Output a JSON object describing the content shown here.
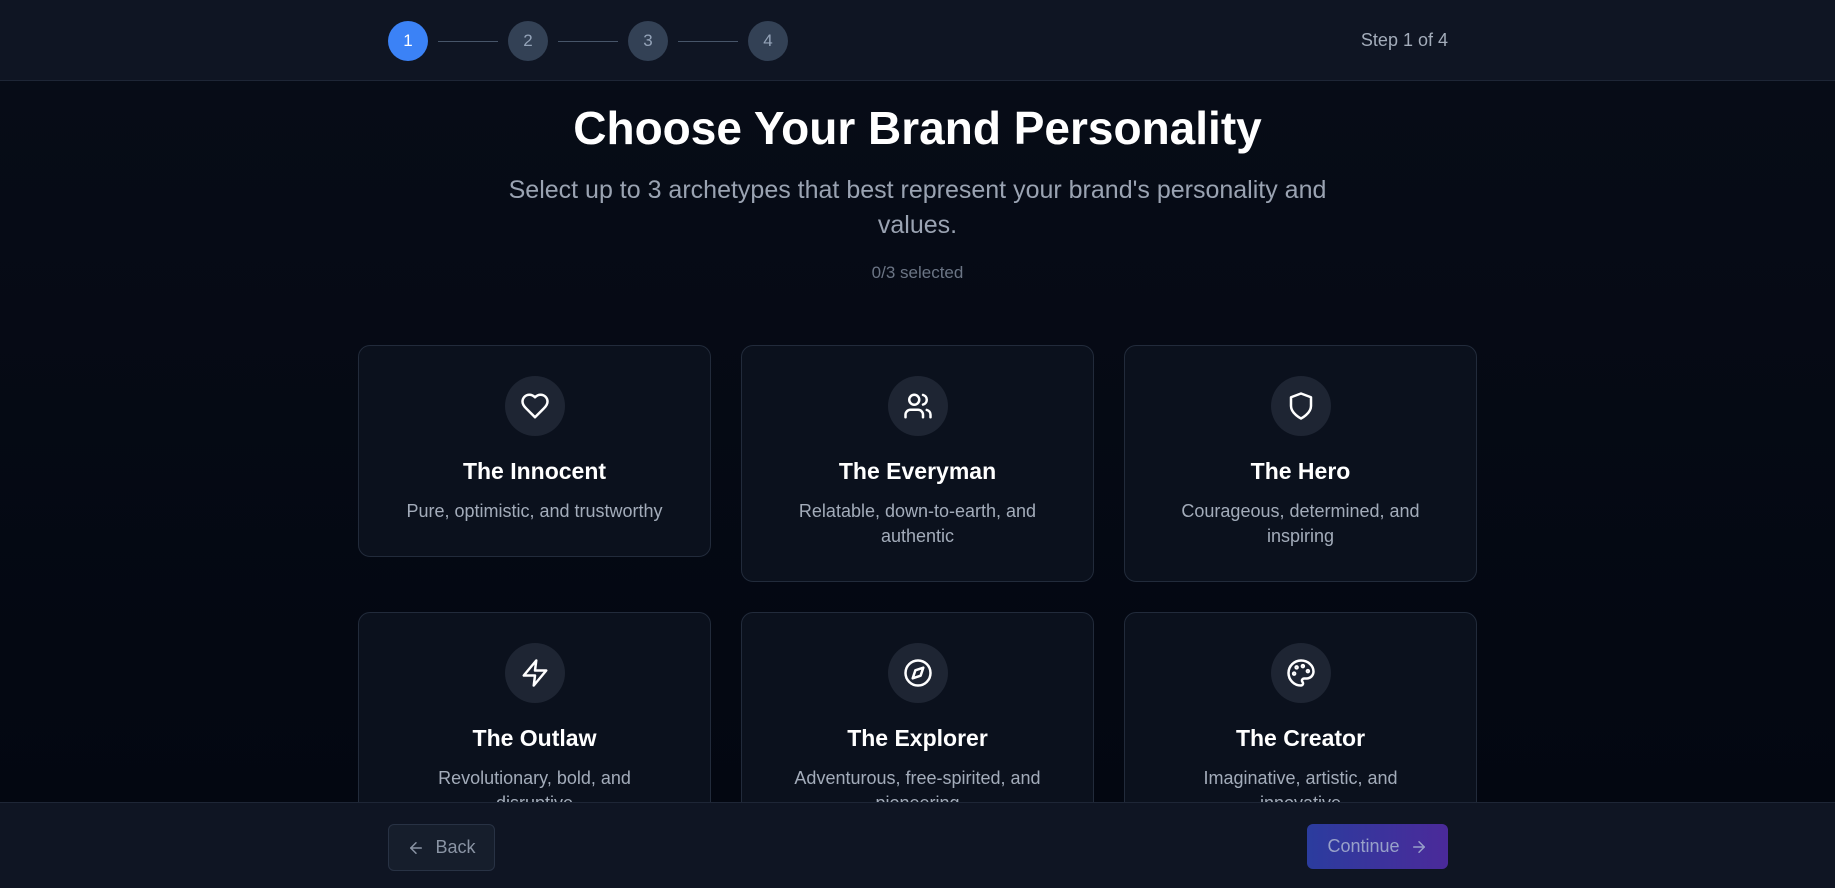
{
  "header": {
    "steps": [
      "1",
      "2",
      "3",
      "4"
    ],
    "active_step": 1,
    "step_label": "Step 1 of 4"
  },
  "main": {
    "title": "Choose Your Brand Personality",
    "subtitle": "Select up to 3 archetypes that best represent your brand's personality and values.",
    "counter": "0/3 selected"
  },
  "cards": [
    {
      "icon": "heart-icon",
      "title": "The Innocent",
      "desc": "Pure, optimistic, and trustworthy"
    },
    {
      "icon": "users-icon",
      "title": "The Everyman",
      "desc": "Relatable, down-to-earth, and authentic"
    },
    {
      "icon": "shield-icon",
      "title": "The Hero",
      "desc": "Courageous, determined, and inspiring"
    },
    {
      "icon": "lightning-icon",
      "title": "The Outlaw",
      "desc": "Revolutionary, bold, and disruptive"
    },
    {
      "icon": "compass-icon",
      "title": "The Explorer",
      "desc": "Adventurous, free-spirited, and pioneering"
    },
    {
      "icon": "palette-icon",
      "title": "The Creator",
      "desc": "Imaginative, artistic, and innovative"
    }
  ],
  "footer": {
    "back_label": "Back",
    "continue_label": "Continue"
  },
  "colors": {
    "accent": "#3b82f6",
    "background": "#030711",
    "continue_gradient_start": "#2b3c9e",
    "continue_gradient_end": "#4b2a9a"
  }
}
